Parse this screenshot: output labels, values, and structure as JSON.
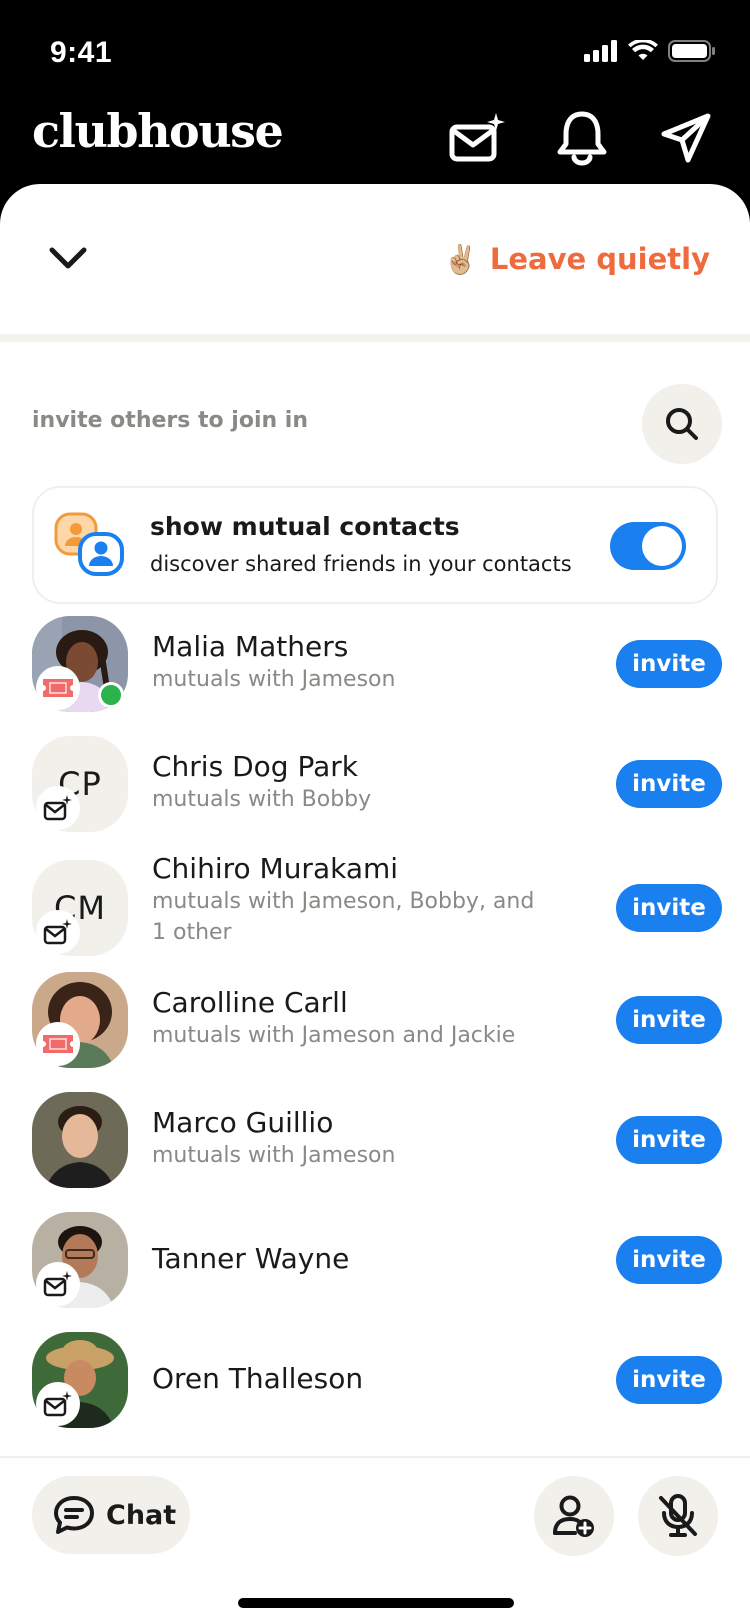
{
  "status": {
    "time": "9:41"
  },
  "header": {
    "logo": "clubhouse",
    "icons": [
      "mail-plus-icon",
      "bell-icon",
      "send-icon"
    ]
  },
  "room": {
    "leave_emoji": "✌🏼",
    "leave_label": "Leave quietly"
  },
  "invite": {
    "label": "invite others to join in",
    "mutual_title": "show mutual contacts",
    "mutual_subtitle": "discover shared friends in your contacts",
    "toggle_on": true
  },
  "contacts": [
    {
      "name": "Malia Mathers",
      "sub": "mutuals with Jameson",
      "avatar": "photo",
      "badge": "ticket-icon",
      "online": true,
      "action": "invite"
    },
    {
      "name": "Chris Dog Park",
      "sub": "mutuals with Bobby",
      "avatar": "initials",
      "initials": "CP",
      "badge": "mail-plus-icon",
      "action": "invite"
    },
    {
      "name": "Chihiro Murakami",
      "sub": "mutuals with Jameson, Bobby, and 1 other",
      "avatar": "initials",
      "initials": "CM",
      "badge": "mail-plus-icon",
      "action": "invite"
    },
    {
      "name": "Carolline Carll",
      "sub": "mutuals with Jameson and Jackie",
      "avatar": "photo",
      "badge": "ticket-icon",
      "action": "invite"
    },
    {
      "name": "Marco Guillio",
      "sub": "mutuals with Jameson",
      "avatar": "photo",
      "action": "invite"
    },
    {
      "name": "Tanner Wayne",
      "sub": "",
      "avatar": "photo",
      "badge": "mail-plus-icon",
      "action": "invite"
    },
    {
      "name": "Oren Thalleson",
      "sub": "",
      "avatar": "photo",
      "badge": "mail-plus-icon",
      "action": "invite"
    }
  ],
  "bottom": {
    "chat_label": "Chat"
  },
  "colors": {
    "accent": "#1A7FEF",
    "leave": "#EF6A3C",
    "surface": "#F1F0EB"
  }
}
